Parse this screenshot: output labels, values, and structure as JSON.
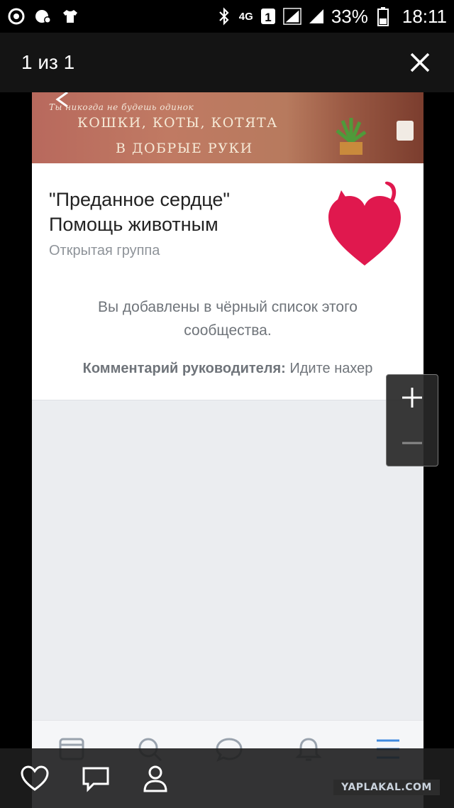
{
  "status_bar": {
    "battery": "33%",
    "time": "18:11",
    "network": "4G"
  },
  "viewer": {
    "counter": "1 из 1"
  },
  "cover": {
    "small_text": "Ты никогда не будешь одинок",
    "line1": "КОШКИ, КОТЫ, КОТЯТА",
    "line2": "В ДОБРЫЕ РУКИ"
  },
  "group": {
    "name": "\"Преданное сердце\" Помощь животным",
    "type": "Открытая группа",
    "blacklist_message": "Вы добавлены в чёрный список этого сообщества.",
    "comment_label": "Комментарий руководителя:",
    "comment_text": " Идите нахер"
  },
  "watermark": "YAPLAKAL.COM",
  "colors": {
    "heart": "#e0184e",
    "tab_active": "#3f8ae0",
    "tab_inactive": "#99a2ad"
  }
}
